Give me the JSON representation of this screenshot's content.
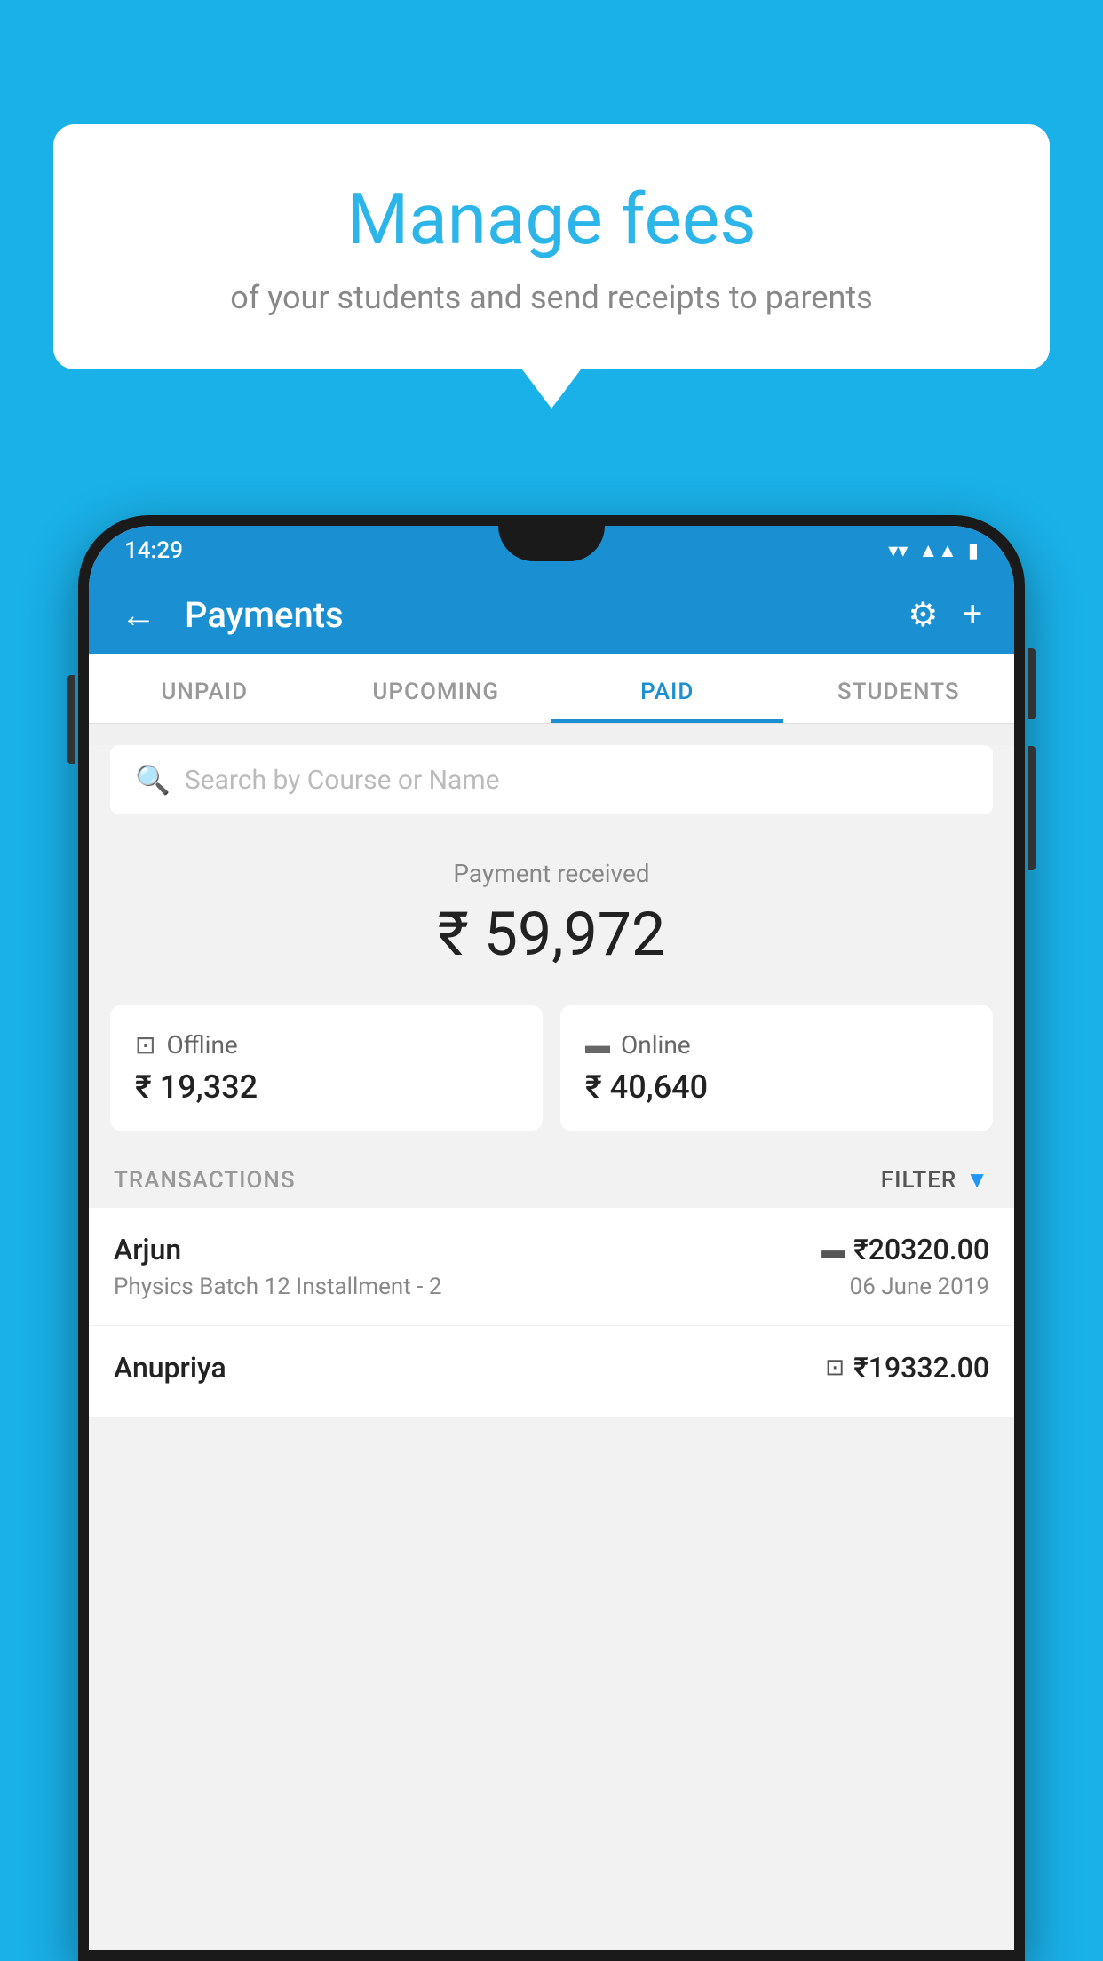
{
  "background_color": "#1ab0e8",
  "speech_bubble": {
    "title": "Manage fees",
    "subtitle": "of your students and send receipts to parents"
  },
  "status_bar": {
    "time": "14:29",
    "signal_icon": "▲▲",
    "battery_icon": "▮"
  },
  "header": {
    "title": "Payments",
    "back_label": "←",
    "settings_label": "⚙",
    "add_label": "+"
  },
  "tabs": [
    {
      "label": "UNPAID",
      "active": false
    },
    {
      "label": "UPCOMING",
      "active": false
    },
    {
      "label": "PAID",
      "active": true
    },
    {
      "label": "STUDENTS",
      "active": false
    }
  ],
  "search": {
    "placeholder": "Search by Course or Name"
  },
  "payment_summary": {
    "label": "Payment received",
    "amount": "₹ 59,972"
  },
  "payment_cards": [
    {
      "type": "Offline",
      "amount": "₹ 19,332",
      "icon": "💳"
    },
    {
      "type": "Online",
      "amount": "₹ 40,640",
      "icon": "💳"
    }
  ],
  "transactions_label": "TRANSACTIONS",
  "filter_label": "FILTER",
  "transactions": [
    {
      "name": "Arjun",
      "course": "Physics Batch 12 Installment - 2",
      "amount": "₹20320.00",
      "date": "06 June 2019",
      "method": "card"
    },
    {
      "name": "Anupriya",
      "course": "",
      "amount": "₹19332.00",
      "date": "",
      "method": "rupee"
    }
  ]
}
